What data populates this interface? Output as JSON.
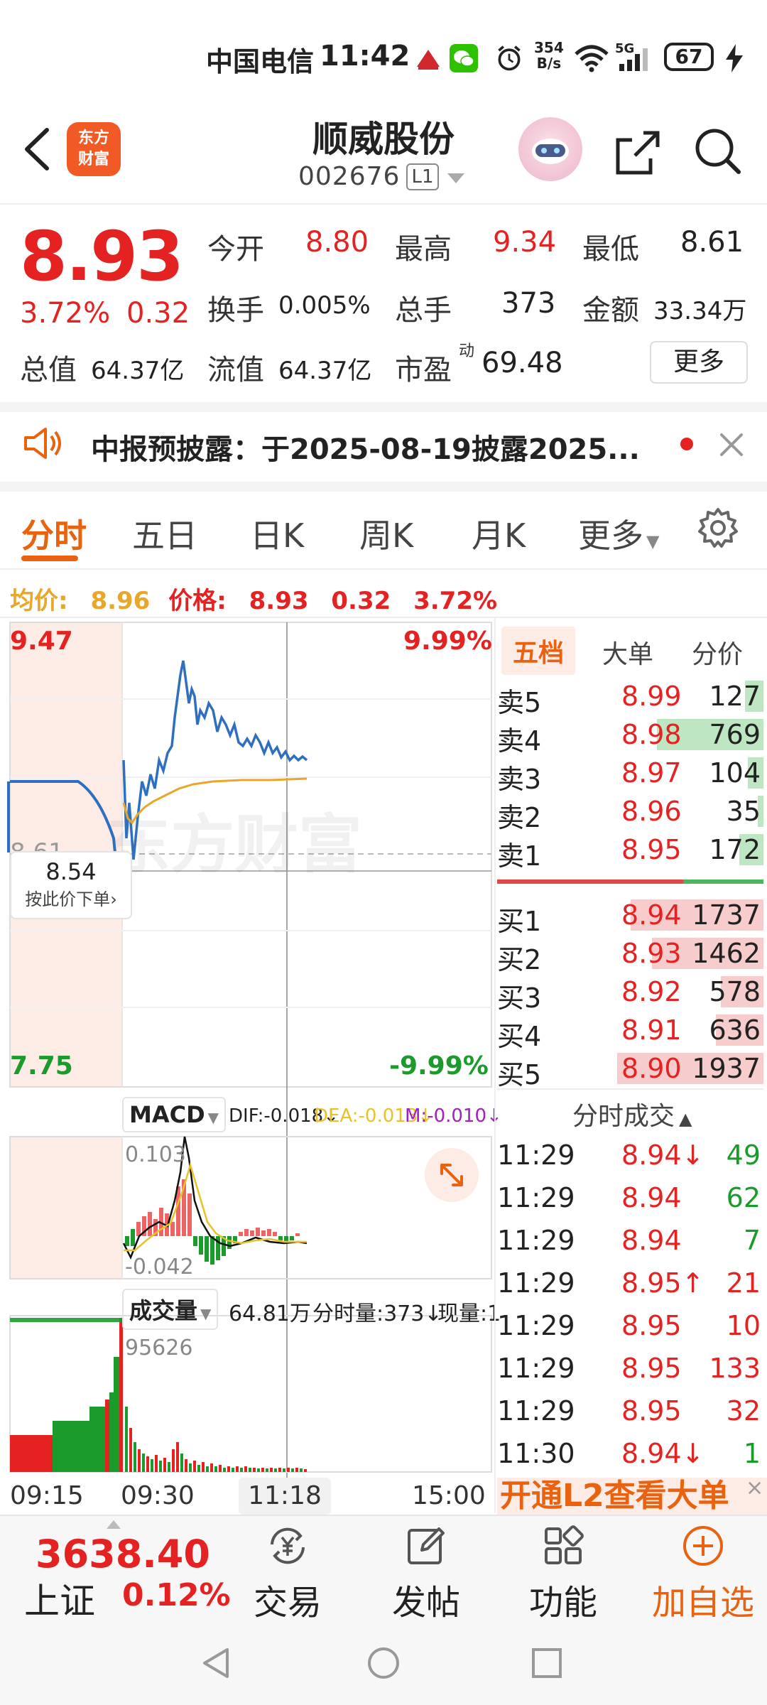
{
  "status_bar": {
    "carrier": "中国电信",
    "time": "11:42",
    "net_speed_top": "354",
    "net_speed_bottom": "B/s",
    "network": "5G",
    "battery": "67"
  },
  "header": {
    "logo_line1": "东方",
    "logo_line2": "财富",
    "stock_name": "顺威股份",
    "stock_code": "002676",
    "level_badge": "L1"
  },
  "quote": {
    "price": "8.93",
    "change_pct": "3.72%",
    "change_amt": "0.32",
    "open_label": "今开",
    "open": "8.80",
    "high_label": "最高",
    "high": "9.34",
    "low_label": "最低",
    "low": "8.61",
    "turnover_label": "换手",
    "turnover": "0.005%",
    "volume_label": "总手",
    "volume": "373",
    "amount_label": "金额",
    "amount": "33.34万",
    "mktcap_label": "总值",
    "mktcap": "64.37亿",
    "float_label": "流值",
    "float_cap": "64.37亿",
    "pe_label": "市盈",
    "pe_sup": "动",
    "pe": "69.48",
    "more_label": "更多"
  },
  "notice": {
    "text": "中报预披露：于2025-08-19披露2025..."
  },
  "tabs": [
    "分时",
    "五日",
    "日K",
    "周K",
    "月K",
    "更多"
  ],
  "avg_row": {
    "avg_label": "均价:",
    "avg_value": "8.96",
    "price_label": "价格:",
    "price_value": "8.93",
    "change_amt": "0.32",
    "change_pct": "3.72%"
  },
  "chart": {
    "y_high": "9.47",
    "y_low": "7.75",
    "pct_high": "9.99%",
    "pct_low": "-9.99%",
    "mid_label_partial": "8.61",
    "order_tip_price": "8.54",
    "order_tip_label": "按此价下单",
    "watermark": "东方财富",
    "macd_label": "MACD",
    "dif": "DIF:-0.018",
    "dea": "DEA:-0.013",
    "m": "M:-0.010",
    "macd_top": "0.103",
    "macd_bottom": "-0.042",
    "vol_label": "成交量",
    "vol_total": "64.81万",
    "vol_min": "分时量:373",
    "vol_now": "现量:1",
    "vol_peak": "95626",
    "time_start": "09:15",
    "time_open": "09:30",
    "time_cursor": "11:18",
    "time_end": "15:00"
  },
  "order_book": {
    "tabs": [
      "五档",
      "大单",
      "分价"
    ],
    "asks": [
      {
        "label": "卖5",
        "price": "8.99",
        "vol": "127"
      },
      {
        "label": "卖4",
        "price": "8.98",
        "vol": "769"
      },
      {
        "label": "卖3",
        "price": "8.97",
        "vol": "104"
      },
      {
        "label": "卖2",
        "price": "8.96",
        "vol": "35"
      },
      {
        "label": "卖1",
        "price": "8.95",
        "vol": "172"
      }
    ],
    "bids": [
      {
        "label": "买1",
        "price": "8.94",
        "vol": "1737"
      },
      {
        "label": "买2",
        "price": "8.93",
        "vol": "1462"
      },
      {
        "label": "买3",
        "price": "8.92",
        "vol": "578"
      },
      {
        "label": "买4",
        "price": "8.91",
        "vol": "636"
      },
      {
        "label": "买5",
        "price": "8.90",
        "vol": "1937"
      }
    ],
    "ticks_title": "分时成交",
    "ticks": [
      {
        "time": "11:29",
        "price": "8.94↓",
        "vol": "49",
        "dir": "down"
      },
      {
        "time": "11:29",
        "price": "8.94",
        "vol": "62",
        "dir": "down"
      },
      {
        "time": "11:29",
        "price": "8.94",
        "vol": "7",
        "dir": "down"
      },
      {
        "time": "11:29",
        "price": "8.95↑",
        "vol": "21",
        "dir": "up"
      },
      {
        "time": "11:29",
        "price": "8.95",
        "vol": "10",
        "dir": "up"
      },
      {
        "time": "11:29",
        "price": "8.95",
        "vol": "133",
        "dir": "up"
      },
      {
        "time": "11:29",
        "price": "8.95",
        "vol": "32",
        "dir": "up"
      },
      {
        "time": "11:30",
        "price": "8.94↓",
        "vol": "1",
        "dir": "down"
      }
    ],
    "l2_banner": "开通L2查看大单"
  },
  "toolbar": {
    "index_value": "3638.40",
    "index_name": "上证",
    "index_change": "0.12%",
    "trade": "交易",
    "post": "发帖",
    "function": "功能",
    "add_watch": "加自选"
  },
  "colors": {
    "up": "#e52222",
    "down": "#1a9b2b",
    "accent": "#e8620f",
    "avg_line": "#e8a72a",
    "price_line": "#2f6fc0"
  }
}
